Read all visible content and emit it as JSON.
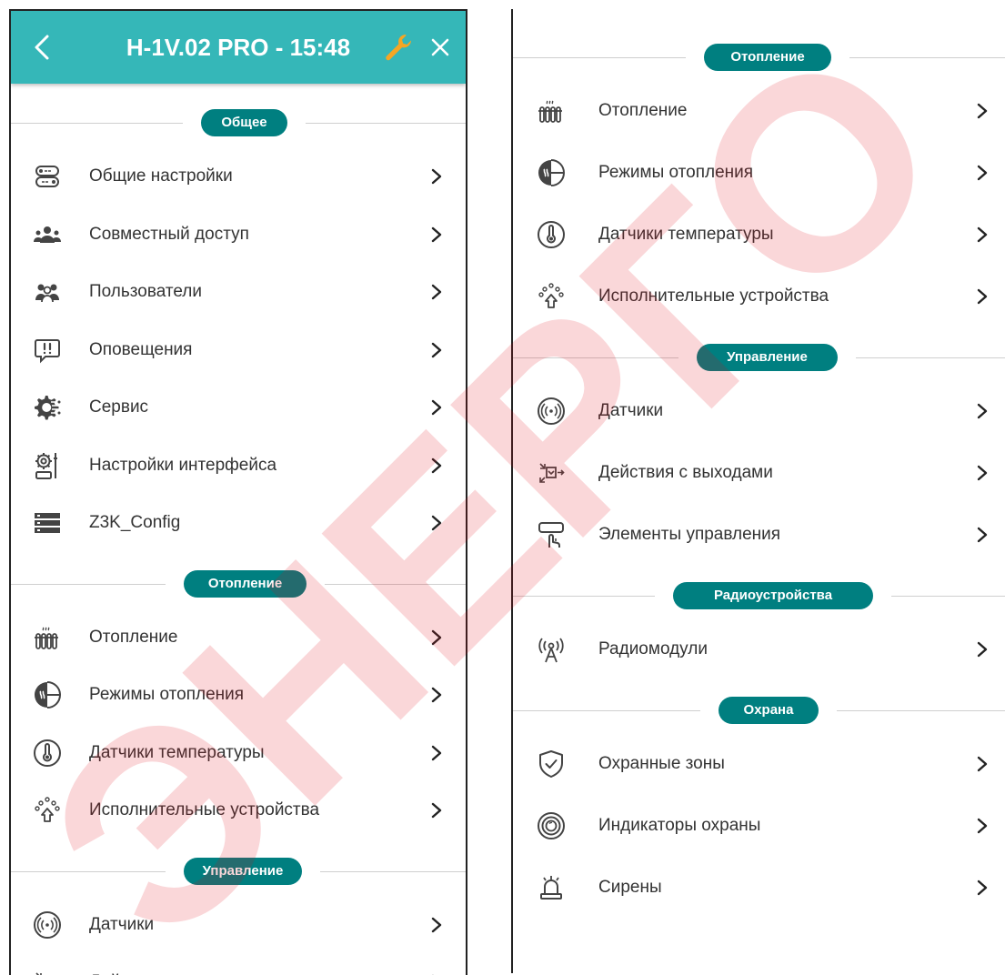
{
  "window": {
    "title": "H-1V.02 PRO - 15:48",
    "back_icon": "chevron-left-icon",
    "settings_icon": "wrench-icon",
    "close_icon": "close-icon",
    "header_color": "#35b7b8",
    "settings_icon_color": "#f5a623"
  },
  "accent_color": "#007f80",
  "watermark": {
    "text": "ЭНЕРГО",
    "color": "#e30613"
  },
  "left_panel": {
    "sections": [
      {
        "label": "Общее",
        "items": [
          {
            "label": "Общие настройки",
            "icon": "toggle-switches-icon"
          },
          {
            "label": "Совместный доступ",
            "icon": "shared-access-icon"
          },
          {
            "label": "Пользователи",
            "icon": "users-icon"
          },
          {
            "label": "Оповещения",
            "icon": "notification-icon"
          },
          {
            "label": "Сервис",
            "icon": "service-gear-icon"
          },
          {
            "label": "Настройки интерфейса",
            "icon": "interface-settings-icon"
          },
          {
            "label": "Z3K_Config",
            "icon": "server-rack-icon"
          }
        ]
      },
      {
        "label": "Отопление",
        "items": [
          {
            "label": "Отопление",
            "icon": "radiator-icon"
          },
          {
            "label": "Режимы отопления",
            "icon": "heating-modes-icon"
          },
          {
            "label": "Датчики температуры",
            "icon": "thermometer-icon"
          },
          {
            "label": "Исполнительные устройства",
            "icon": "actuator-icon"
          }
        ]
      },
      {
        "label": "Управление",
        "items": [
          {
            "label": "Датчики",
            "icon": "sensor-wave-icon"
          },
          {
            "label": "Действия с выходами",
            "icon": "output-actions-icon"
          }
        ]
      }
    ]
  },
  "right_panel": {
    "sections": [
      {
        "label": "Отопление",
        "items": [
          {
            "label": "Отопление",
            "icon": "radiator-icon"
          },
          {
            "label": "Режимы отопления",
            "icon": "heating-modes-icon"
          },
          {
            "label": "Датчики температуры",
            "icon": "thermometer-icon"
          },
          {
            "label": "Исполнительные устройства",
            "icon": "actuator-icon"
          }
        ]
      },
      {
        "label": "Управление",
        "items": [
          {
            "label": "Датчики",
            "icon": "sensor-wave-icon"
          },
          {
            "label": "Действия с выходами",
            "icon": "output-actions-icon"
          },
          {
            "label": "Элементы управления",
            "icon": "touch-control-icon"
          }
        ]
      },
      {
        "label": "Радиоустройства",
        "items": [
          {
            "label": "Радиомодули",
            "icon": "radio-antenna-icon"
          }
        ]
      },
      {
        "label": "Охрана",
        "items": [
          {
            "label": "Охранные зоны",
            "icon": "shield-check-icon"
          },
          {
            "label": "Индикаторы охраны",
            "icon": "security-indicator-icon"
          },
          {
            "label": "Сирены",
            "icon": "siren-icon"
          }
        ]
      }
    ]
  }
}
